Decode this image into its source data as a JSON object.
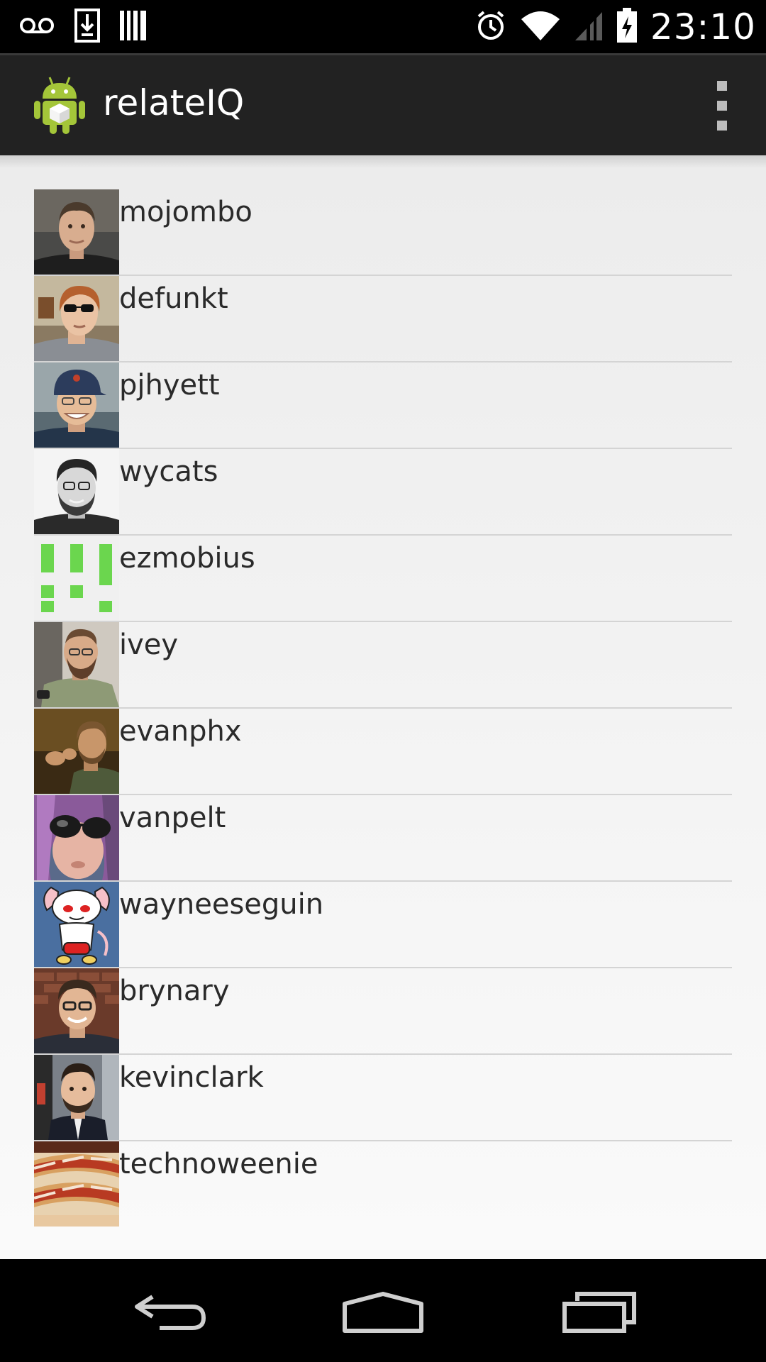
{
  "status_bar": {
    "time": "23:10",
    "left_icons": [
      "voicemail-icon",
      "download-icon",
      "barcode-icon"
    ],
    "right_icons": [
      "alarm-icon",
      "wifi-icon",
      "signal-icon",
      "battery-charging-icon"
    ]
  },
  "action_bar": {
    "title": "relateIQ",
    "app_icon": "android-icon",
    "overflow_icon": "overflow-menu-icon"
  },
  "users": [
    {
      "login": "mojombo",
      "avatar": "photo-avatar"
    },
    {
      "login": "defunkt",
      "avatar": "photo-avatar"
    },
    {
      "login": "pjhyett",
      "avatar": "photo-avatar"
    },
    {
      "login": "wycats",
      "avatar": "photo-avatar"
    },
    {
      "login": "ezmobius",
      "avatar": "identicon-avatar"
    },
    {
      "login": "ivey",
      "avatar": "photo-avatar"
    },
    {
      "login": "evanphx",
      "avatar": "photo-avatar"
    },
    {
      "login": "vanpelt",
      "avatar": "photo-avatar"
    },
    {
      "login": "wayneeseguin",
      "avatar": "cartoon-avatar"
    },
    {
      "login": "brynary",
      "avatar": "photo-avatar"
    },
    {
      "login": "kevinclark",
      "avatar": "photo-avatar"
    },
    {
      "login": "technoweenie",
      "avatar": "food-photo-avatar"
    }
  ],
  "nav_bar": {
    "back_icon": "back-icon",
    "home_icon": "home-icon",
    "recents_icon": "recent-apps-icon"
  },
  "colors": {
    "status_bar_bg": "#000000",
    "action_bar_bg": "#222222",
    "list_bg": "#efefef",
    "divider": "#d4d4d4",
    "text": "#2a2a2a",
    "identicon_green": "#6bd64e",
    "android_green": "#a4c639"
  }
}
